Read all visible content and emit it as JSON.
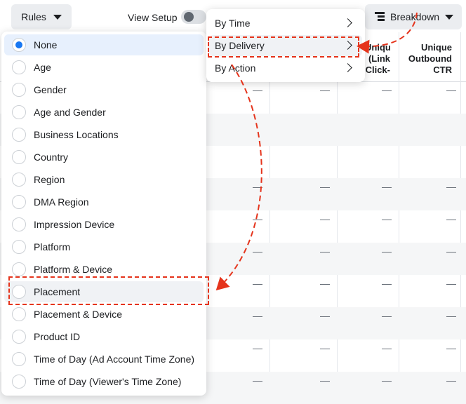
{
  "toolbar": {
    "rules_label": "Rules",
    "view_setup_label": "View Setup",
    "breakdown_label": "Breakdown"
  },
  "table": {
    "headers": [
      "Unique\n(Link\nClick-",
      "Unique\nOutbound\nCTR"
    ],
    "empty_value": "—"
  },
  "breakdown_menu": {
    "items": [
      {
        "label": "By Time"
      },
      {
        "label": "By Delivery"
      },
      {
        "label": "By Action"
      }
    ]
  },
  "delivery_options": {
    "selected": "None",
    "items": [
      {
        "label": "None"
      },
      {
        "label": "Age"
      },
      {
        "label": "Gender"
      },
      {
        "label": "Age and Gender"
      },
      {
        "label": "Business Locations"
      },
      {
        "label": "Country"
      },
      {
        "label": "Region"
      },
      {
        "label": "DMA Region"
      },
      {
        "label": "Impression Device"
      },
      {
        "label": "Platform"
      },
      {
        "label": "Platform & Device"
      },
      {
        "label": "Placement"
      },
      {
        "label": "Placement & Device"
      },
      {
        "label": "Product ID"
      },
      {
        "label": "Time of Day (Ad Account Time Zone)"
      },
      {
        "label": "Time of Day (Viewer's Time Zone)"
      }
    ]
  },
  "colors": {
    "accent": "#1877f2",
    "annotation": "#e5341c"
  }
}
